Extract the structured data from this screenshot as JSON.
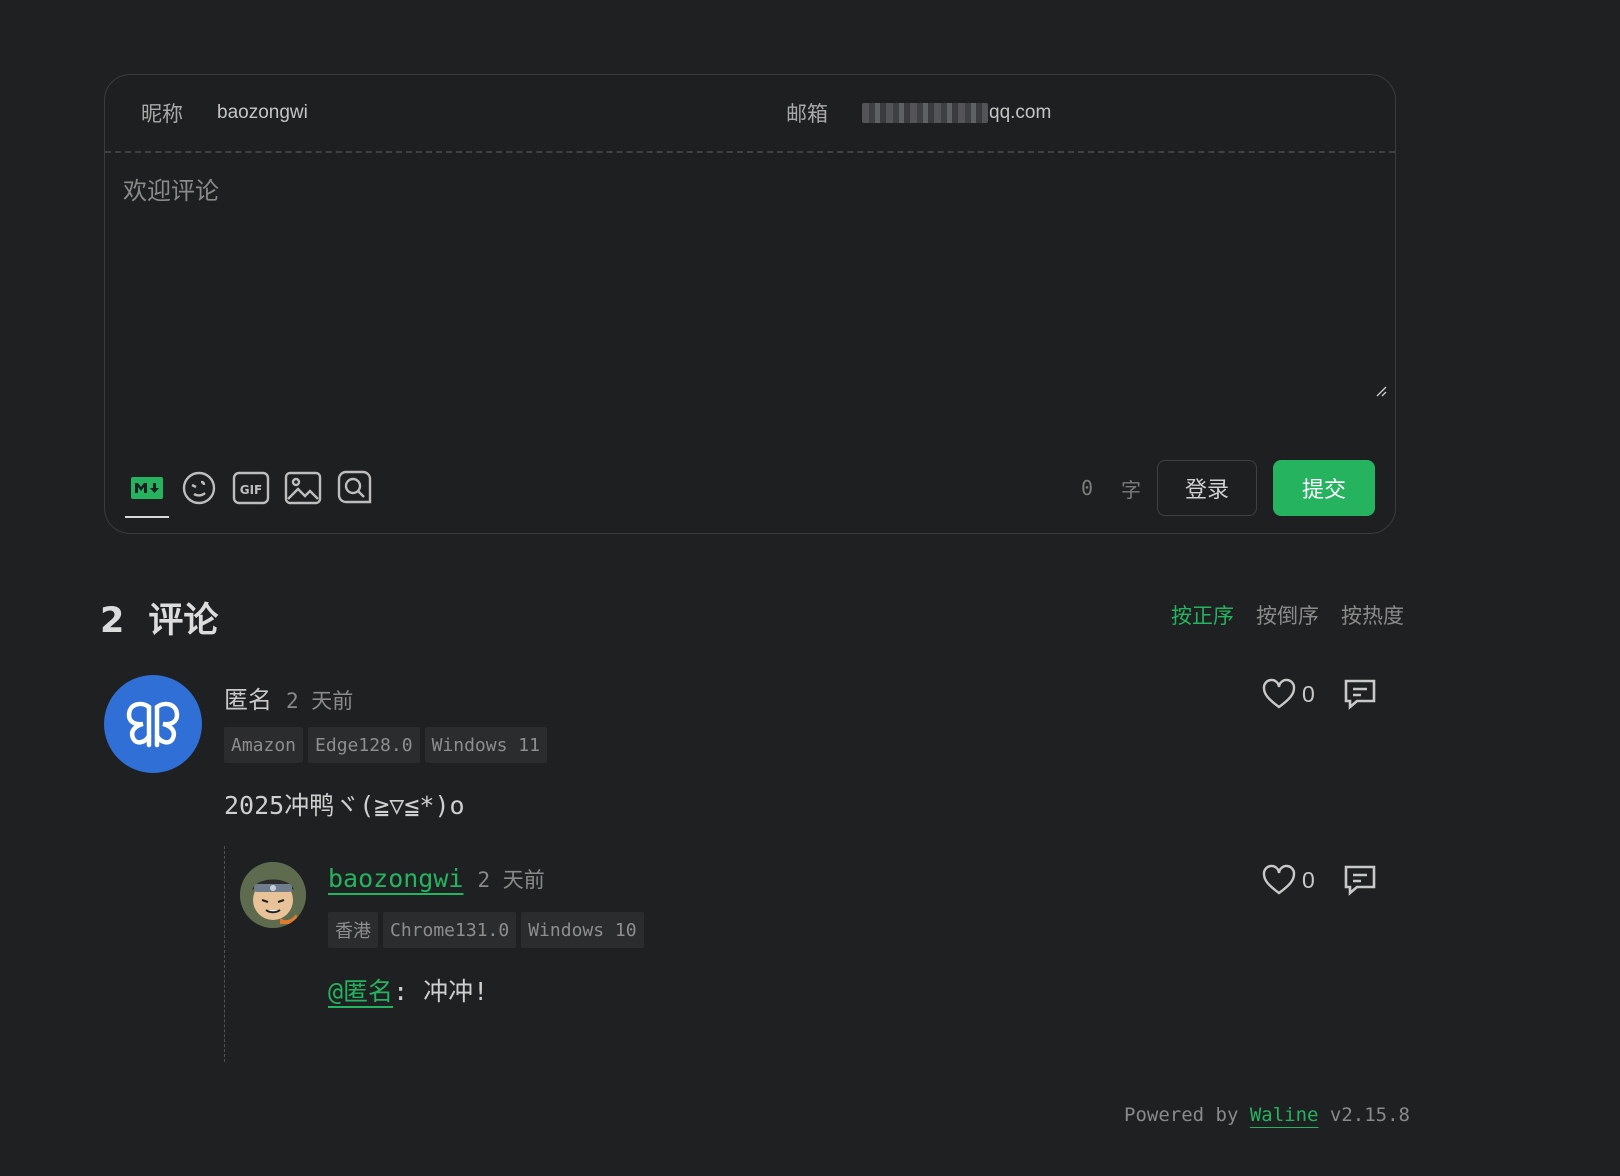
{
  "form": {
    "nick_label": "昵称",
    "nick_value": "baozongwi",
    "email_label": "邮箱",
    "email_visible_suffix": "qq.com",
    "textarea_placeholder": "欢迎评论",
    "toolbar_icons": [
      "markdown-icon",
      "emoji-icon",
      "gif-icon",
      "image-icon",
      "preview-icon"
    ],
    "word_count": "0",
    "word_unit": "字",
    "login_label": "登录",
    "submit_label": "提交",
    "accent_color": "#25b35f"
  },
  "list": {
    "count": "2",
    "count_label": "评论",
    "sort_tabs": [
      {
        "label": "按正序",
        "active": true
      },
      {
        "label": "按倒序",
        "active": false
      },
      {
        "label": "按热度",
        "active": false
      }
    ]
  },
  "comments": [
    {
      "author": "匿名",
      "time": "2 天前",
      "badges": [
        "Amazon",
        "Edge128.0",
        "Windows 11"
      ],
      "content": "2025冲鸭ヾ(≧▽≦*)o",
      "likes": "0",
      "avatar": "butterfly-avatar",
      "replies": [
        {
          "author": "baozongwi",
          "time": "2 天前",
          "badges": [
            "香港",
            "Chrome131.0",
            "Windows 10"
          ],
          "mention": "@匿名",
          "content": ": 冲冲!",
          "likes": "0",
          "avatar": "anime-avatar"
        }
      ]
    }
  ],
  "footer": {
    "prefix": "Powered by ",
    "link": "Waline",
    "version": " v2.15.8"
  }
}
